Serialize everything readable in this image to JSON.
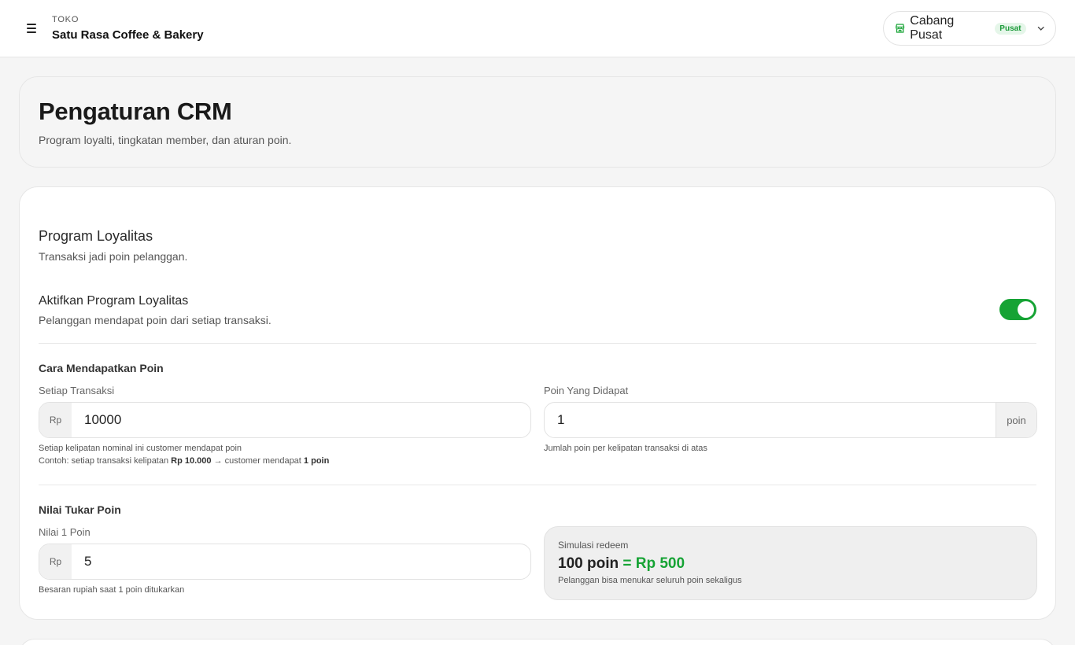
{
  "header": {
    "store_label": "TOKO",
    "store_name": "Satu Rasa Coffee & Bakery",
    "branch": {
      "name": "Cabang Pusat",
      "badge": "Pusat",
      "icon": "store-icon"
    },
    "menu_icon": "hamburger-icon"
  },
  "page": {
    "title": "Pengaturan CRM",
    "subtitle": "Program loyalti, tingkatan member, dan aturan poin."
  },
  "loyalty": {
    "title": "Program Loyalitas",
    "subtitle": "Transaksi jadi poin pelanggan.",
    "toggle_label": "Aktifkan Program Loyalitas",
    "toggle_sub": "Pelanggan mendapat poin dari setiap transaksi.",
    "enabled": true,
    "earn": {
      "title": "Cara Mendapatkan Poin",
      "per_tx_label": "Setiap Transaksi",
      "per_tx_prefix": "Rp",
      "per_tx_value": "10000",
      "per_tx_help": "Setiap kelipatan nominal ini customer mendapat poin",
      "example_prefix": "Contoh: setiap transaksi kelipatan ",
      "example_amount": "Rp 10.000",
      "example_mid": " → customer mendapat ",
      "example_points": "1 poin",
      "points_label": "Poin Yang Didapat",
      "points_value": "1",
      "points_suffix": "poin",
      "points_help": "Jumlah poin per kelipatan transaksi di atas"
    },
    "redeem": {
      "title": "Nilai Tukar Poin",
      "value_label": "Nilai 1 Poin",
      "value_prefix": "Rp",
      "value": "5",
      "value_help": "Besaran rupiah saat 1 poin ditukarkan",
      "sim_label": "Simulasi redeem",
      "sim_points": "100 poin ",
      "sim_result": "= Rp 500",
      "sim_note": "Pelanggan bisa menukar seluruh poin sekaligus"
    }
  },
  "colors": {
    "accent": "#16a334",
    "badge_bg": "#e5f6e9"
  }
}
